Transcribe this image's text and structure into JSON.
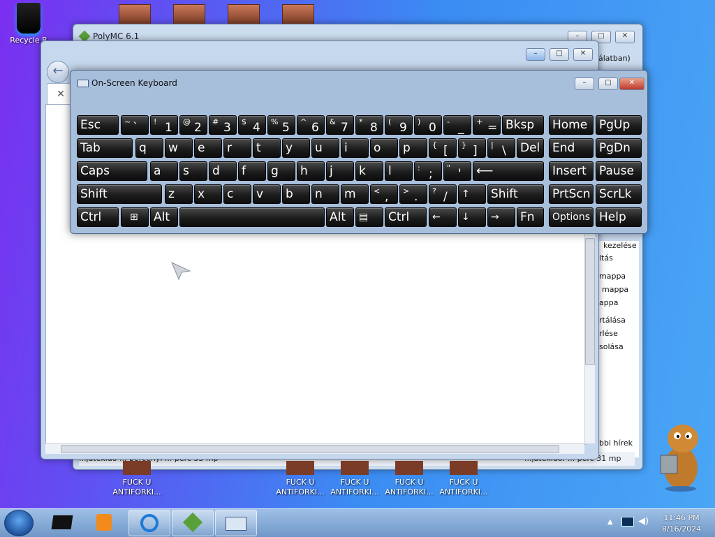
{
  "desktop": {
    "recycle_bin_label": "Recycle B",
    "shortcut_label": "FUCK U\nANTIFORKI..."
  },
  "back_window": {
    "title": "PolyMC 6.1",
    "side_items": [
      "álatban)",
      "kezelése",
      "ltás",
      "mappa",
      "mappa",
      "appa",
      "rtálása",
      "rlése",
      "solása",
      "bbi hírek"
    ],
    "status_left": "...játékidő ... percenyi ... perc 33 mp",
    "status_right": "...játékidő: ... perc 31 mp"
  },
  "osk": {
    "title": "On-Screen Keyboard",
    "keys": {
      "esc": "Esc",
      "tilde_sup": "~",
      "tilde_main": "`",
      "n1s": "!",
      "n1": "1",
      "n2s": "@",
      "n2": "2",
      "n3s": "#",
      "n3": "3",
      "n4s": "$",
      "n4": "4",
      "n5s": "%",
      "n5": "5",
      "n6s": "^",
      "n6": "6",
      "n7s": "&",
      "n7": "7",
      "n8s": "*",
      "n8": "8",
      "n9s": "(",
      "n9": "9",
      "n0s": ")",
      "n0": "0",
      "minus_s": "_",
      "minus": "-",
      "plus_s": "+",
      "plus": "=",
      "bksp": "Bksp",
      "home": "Home",
      "pgup": "PgUp",
      "tab": "Tab",
      "q": "q",
      "w": "w",
      "e": "e",
      "r": "r",
      "t": "t",
      "y": "y",
      "u": "u",
      "i": "i",
      "o": "o",
      "p": "p",
      "lbr_s": "{",
      "lbr": "[",
      "rbr_s": "}",
      "rbr": "]",
      "bsl_s": "|",
      "bsl": "\\",
      "del": "Del",
      "end": "End",
      "pgdn": "PgDn",
      "caps": "Caps",
      "a": "a",
      "s": "s",
      "d": "d",
      "f": "f",
      "g": "g",
      "h": "h",
      "j": "j",
      "k": "k",
      "l": "l",
      "semi_s": ":",
      "semi": ";",
      "quote_s": "\"",
      "quote": "'",
      "enter": "⟵",
      "insert": "Insert",
      "pause": "Pause",
      "shift": "Shift",
      "z": "z",
      "x": "x",
      "c": "c",
      "v": "v",
      "b": "b",
      "n": "n",
      "m": "m",
      "comma_s": "<",
      "comma": ",",
      "dot_s": ">",
      "dot": ".",
      "slash_s": "?",
      "slash": "/",
      "up": "↑",
      "shift_r": "Shift",
      "prtscn": "PrtScn",
      "scrlk": "ScrLk",
      "ctrl": "Ctrl",
      "win": "⊞",
      "alt": "Alt",
      "alt_r": "Alt",
      "menu": "▤",
      "ctrl_r": "Ctrl",
      "left": "←",
      "down": "↓",
      "right": "→",
      "fn": "Fn",
      "options": "Options",
      "help": "Help"
    }
  },
  "taskbar": {
    "time": "11:46 PM",
    "date": "8/16/2024"
  },
  "colors": {
    "desktop_left": "#7a2ff0",
    "desktop_right": "#4aa6f5",
    "key_bg": "#1c1c1c"
  }
}
